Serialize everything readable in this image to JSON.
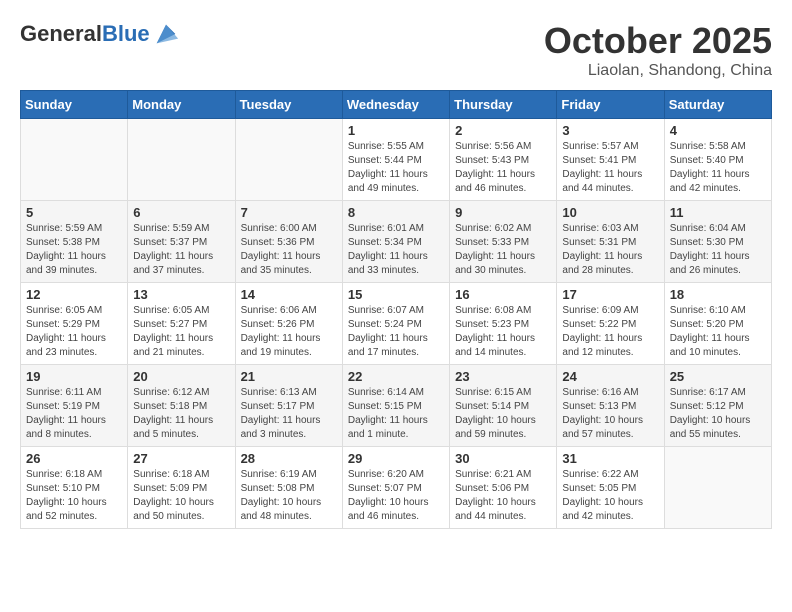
{
  "logo": {
    "general": "General",
    "blue": "Blue"
  },
  "header": {
    "month": "October 2025",
    "location": "Liaolan, Shandong, China"
  },
  "weekdays": [
    "Sunday",
    "Monday",
    "Tuesday",
    "Wednesday",
    "Thursday",
    "Friday",
    "Saturday"
  ],
  "weeks": [
    [
      {
        "day": "",
        "info": ""
      },
      {
        "day": "",
        "info": ""
      },
      {
        "day": "",
        "info": ""
      },
      {
        "day": "1",
        "info": "Sunrise: 5:55 AM\nSunset: 5:44 PM\nDaylight: 11 hours\nand 49 minutes."
      },
      {
        "day": "2",
        "info": "Sunrise: 5:56 AM\nSunset: 5:43 PM\nDaylight: 11 hours\nand 46 minutes."
      },
      {
        "day": "3",
        "info": "Sunrise: 5:57 AM\nSunset: 5:41 PM\nDaylight: 11 hours\nand 44 minutes."
      },
      {
        "day": "4",
        "info": "Sunrise: 5:58 AM\nSunset: 5:40 PM\nDaylight: 11 hours\nand 42 minutes."
      }
    ],
    [
      {
        "day": "5",
        "info": "Sunrise: 5:59 AM\nSunset: 5:38 PM\nDaylight: 11 hours\nand 39 minutes."
      },
      {
        "day": "6",
        "info": "Sunrise: 5:59 AM\nSunset: 5:37 PM\nDaylight: 11 hours\nand 37 minutes."
      },
      {
        "day": "7",
        "info": "Sunrise: 6:00 AM\nSunset: 5:36 PM\nDaylight: 11 hours\nand 35 minutes."
      },
      {
        "day": "8",
        "info": "Sunrise: 6:01 AM\nSunset: 5:34 PM\nDaylight: 11 hours\nand 33 minutes."
      },
      {
        "day": "9",
        "info": "Sunrise: 6:02 AM\nSunset: 5:33 PM\nDaylight: 11 hours\nand 30 minutes."
      },
      {
        "day": "10",
        "info": "Sunrise: 6:03 AM\nSunset: 5:31 PM\nDaylight: 11 hours\nand 28 minutes."
      },
      {
        "day": "11",
        "info": "Sunrise: 6:04 AM\nSunset: 5:30 PM\nDaylight: 11 hours\nand 26 minutes."
      }
    ],
    [
      {
        "day": "12",
        "info": "Sunrise: 6:05 AM\nSunset: 5:29 PM\nDaylight: 11 hours\nand 23 minutes."
      },
      {
        "day": "13",
        "info": "Sunrise: 6:05 AM\nSunset: 5:27 PM\nDaylight: 11 hours\nand 21 minutes."
      },
      {
        "day": "14",
        "info": "Sunrise: 6:06 AM\nSunset: 5:26 PM\nDaylight: 11 hours\nand 19 minutes."
      },
      {
        "day": "15",
        "info": "Sunrise: 6:07 AM\nSunset: 5:24 PM\nDaylight: 11 hours\nand 17 minutes."
      },
      {
        "day": "16",
        "info": "Sunrise: 6:08 AM\nSunset: 5:23 PM\nDaylight: 11 hours\nand 14 minutes."
      },
      {
        "day": "17",
        "info": "Sunrise: 6:09 AM\nSunset: 5:22 PM\nDaylight: 11 hours\nand 12 minutes."
      },
      {
        "day": "18",
        "info": "Sunrise: 6:10 AM\nSunset: 5:20 PM\nDaylight: 11 hours\nand 10 minutes."
      }
    ],
    [
      {
        "day": "19",
        "info": "Sunrise: 6:11 AM\nSunset: 5:19 PM\nDaylight: 11 hours\nand 8 minutes."
      },
      {
        "day": "20",
        "info": "Sunrise: 6:12 AM\nSunset: 5:18 PM\nDaylight: 11 hours\nand 5 minutes."
      },
      {
        "day": "21",
        "info": "Sunrise: 6:13 AM\nSunset: 5:17 PM\nDaylight: 11 hours\nand 3 minutes."
      },
      {
        "day": "22",
        "info": "Sunrise: 6:14 AM\nSunset: 5:15 PM\nDaylight: 11 hours\nand 1 minute."
      },
      {
        "day": "23",
        "info": "Sunrise: 6:15 AM\nSunset: 5:14 PM\nDaylight: 10 hours\nand 59 minutes."
      },
      {
        "day": "24",
        "info": "Sunrise: 6:16 AM\nSunset: 5:13 PM\nDaylight: 10 hours\nand 57 minutes."
      },
      {
        "day": "25",
        "info": "Sunrise: 6:17 AM\nSunset: 5:12 PM\nDaylight: 10 hours\nand 55 minutes."
      }
    ],
    [
      {
        "day": "26",
        "info": "Sunrise: 6:18 AM\nSunset: 5:10 PM\nDaylight: 10 hours\nand 52 minutes."
      },
      {
        "day": "27",
        "info": "Sunrise: 6:18 AM\nSunset: 5:09 PM\nDaylight: 10 hours\nand 50 minutes."
      },
      {
        "day": "28",
        "info": "Sunrise: 6:19 AM\nSunset: 5:08 PM\nDaylight: 10 hours\nand 48 minutes."
      },
      {
        "day": "29",
        "info": "Sunrise: 6:20 AM\nSunset: 5:07 PM\nDaylight: 10 hours\nand 46 minutes."
      },
      {
        "day": "30",
        "info": "Sunrise: 6:21 AM\nSunset: 5:06 PM\nDaylight: 10 hours\nand 44 minutes."
      },
      {
        "day": "31",
        "info": "Sunrise: 6:22 AM\nSunset: 5:05 PM\nDaylight: 10 hours\nand 42 minutes."
      },
      {
        "day": "",
        "info": ""
      }
    ]
  ]
}
